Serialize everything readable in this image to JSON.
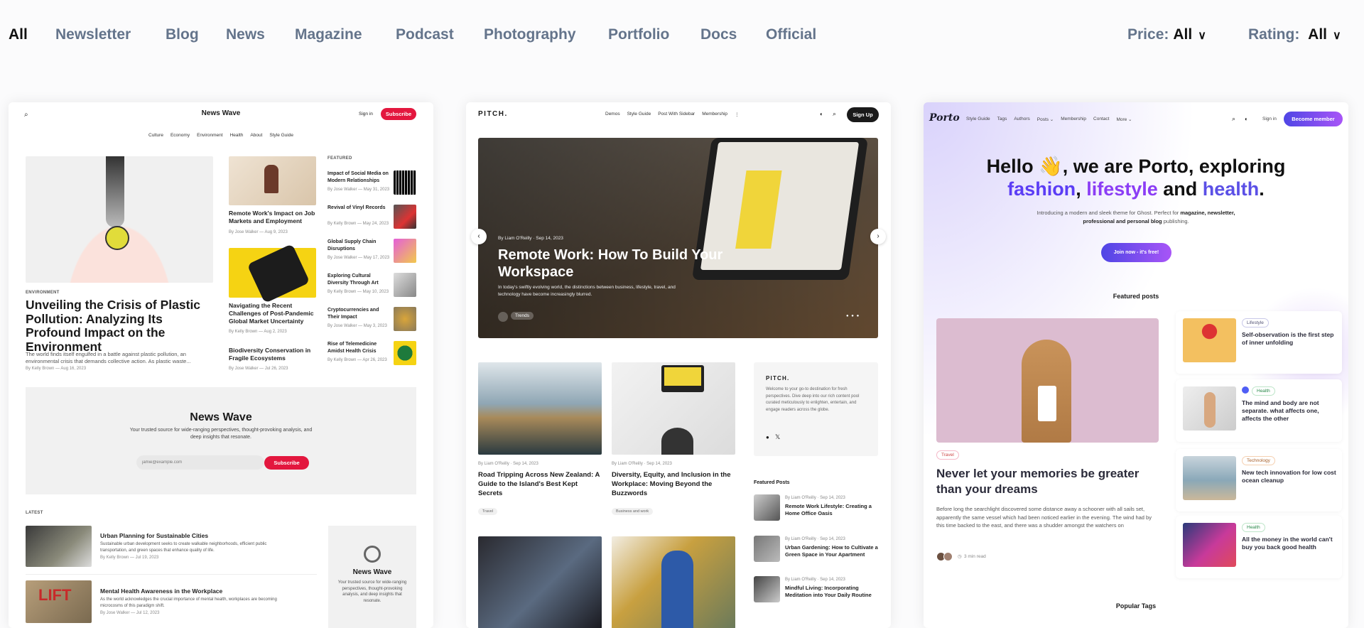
{
  "filters": {
    "categories": [
      "All",
      "Newsletter",
      "Blog",
      "News",
      "Magazine",
      "Podcast",
      "Photography",
      "Portfolio",
      "Docs",
      "Official"
    ],
    "active": "All",
    "price": {
      "label": "Price:",
      "value": "All"
    },
    "rating": {
      "label": "Rating: ",
      "value": "All"
    }
  },
  "newswave": {
    "title": "News Wave",
    "sign_in": "Sign in",
    "subscribe": "Subscribe",
    "nav": [
      "Culture",
      "Economy",
      "Environment",
      "Health",
      "About",
      "Style Guide"
    ],
    "hero": {
      "category": "ENVIRONMENT",
      "title": "Unveiling the Crisis of Plastic Pollution: Analyzing Its Profound Impact on the Environment",
      "excerpt": "The world finds itself engulfed in a battle against plastic pollution, an environmental crisis that demands collective action. As plastic waste...",
      "meta": "By Kelly Brown — Aug 16, 2023"
    },
    "middle": [
      {
        "title": "Remote Work's Impact on Job Markets and Employment",
        "meta": "By Jose Walker — Aug 9, 2023"
      },
      {
        "title": "Navigating the Recent Challenges of Post-Pandemic Global Market Uncertainty",
        "meta": "By Kelly Brown — Aug 2, 2023"
      },
      {
        "title": "Biodiversity Conservation in Fragile Ecosystems",
        "meta": "By Jose Walker — Jul 26, 2023"
      }
    ],
    "featured_label": "FEATURED",
    "featured": [
      {
        "title": "Impact of Social Media on Modern Relationships",
        "meta": "By Jose Walker — May 31, 2023"
      },
      {
        "title": "Revival of Vinyl Records",
        "meta": "By Kelly Brown — May 24, 2023"
      },
      {
        "title": "Global Supply Chain Disruptions",
        "meta": "By Jose Walker — May 17, 2023"
      },
      {
        "title": "Exploring Cultural Diversity Through Art",
        "meta": "By Kelly Brown — May 10, 2023"
      },
      {
        "title": "Cryptocurrencies and Their Impact",
        "meta": "By Jose Walker — May 3, 2023"
      },
      {
        "title": "Rise of Telemedicine Amidst Health Crisis",
        "meta": "By Kelly Brown — Apr 26, 2023"
      }
    ],
    "newsletter": {
      "title": "News Wave",
      "description": "Your trusted source for wide-ranging perspectives, thought-provoking analysis, and deep insights that resonate.",
      "placeholder": "jamie@example.com",
      "button": "Subscribe"
    },
    "latest_label": "LATEST",
    "latest": [
      {
        "title": "Urban Planning for Sustainable Cities",
        "excerpt": "Sustainable urban development seeks to create walkable neighborhoods, efficient public transportation, and green spaces that enhance quality of life.",
        "meta": "By Kelly Brown — Jul 19, 2023"
      },
      {
        "title": "Mental Health Awareness in the Workplace",
        "excerpt": "As the world acknowledges the crucial importance of mental health, workplaces are becoming microcosms of this paradigm shift.",
        "meta": "By Jose Walker — Jul 12, 2023"
      }
    ],
    "sidebar": {
      "title": "News Wave",
      "description": "Your trusted source for wide-ranging perspectives, thought-provoking analysis, and deep insights that resonate."
    },
    "accent": "#e3173e"
  },
  "pitch": {
    "logo": "PITCH.",
    "nav": [
      "Demos",
      "Style Guide",
      "Post With Sidebar",
      "Membership"
    ],
    "sign_up": "Sign Up",
    "hero": {
      "meta": "By Liam O'Reilly · Sep 14, 2023",
      "title": "Remote Work: How To Build Your Workspace",
      "excerpt": "In today's swiftly evolving world, the distinctions between business, lifestyle, travel, and technology have become increasingly blurred.",
      "tag": "Trends"
    },
    "posts": [
      {
        "meta": "By Liam O'Reilly · Sep 14, 2023",
        "title": "Road Tripping Across New Zealand: A Guide to the Island's Best Kept Secrets",
        "tag": "Travel"
      },
      {
        "meta": "By Liam O'Reilly · Sep 14, 2023",
        "title": "Diversity, Equity, and Inclusion in the Workplace: Moving Beyond the Buzzwords",
        "tag": "Business and work"
      }
    ],
    "about": {
      "logo": "PITCH.",
      "description": "Welcome to your go-to destination for fresh perspectives. Dive deep into our rich content pool curated meticulously to enlighten, entertain, and engage readers across the globe."
    },
    "featured_label": "Featured Posts",
    "featured": [
      {
        "meta": "By Liam O'Reilly · Sep 14, 2023",
        "title": "Remote Work Lifestyle: Creating a Home Office Oasis"
      },
      {
        "meta": "By Liam O'Reilly · Sep 14, 2023",
        "title": "Urban Gardening: How to Cultivate a Green Space in Your Apartment"
      },
      {
        "meta": "By Liam O'Reilly · Sep 14, 2023",
        "title": "Mindful Living: Incorporating Meditation into Your Daily Routine"
      }
    ]
  },
  "porto": {
    "logo": "Porto",
    "nav": [
      "Style Guide",
      "Tags",
      "Authors",
      "Posts ⌄",
      "Membership",
      "Contact",
      "More ⌄"
    ],
    "sign_in": "Sign in",
    "cta": "Become member",
    "hero": {
      "line1_a": "Hello ",
      "emoji": "👋",
      "line1_b": ", we are Porto, exploring",
      "w1": "fashion",
      "w2": "lifestyle",
      "and": " and ",
      "w3": "health",
      "subtitle_a": "Introducing a modern and sleek theme for Ghost. Perfect for ",
      "subtitle_b": "magazine, newsletter, professional and personal blog",
      "subtitle_c": " publishing.",
      "button": "Join now - it's free!"
    },
    "featured_label": "Featured posts",
    "main_post": {
      "tag": "Travel",
      "title": "Never let your memories be greater than your dreams",
      "excerpt": "Before long the searchlight discovered some distance away a schooner with all sails set, apparently the same vessel which had been noticed earlier in the evening. The wind had by this time backed to the east, and there was a shudder amongst the watchers on",
      "read_time": "3 min read"
    },
    "side_posts": [
      {
        "tag": "Lifestyle",
        "title": "Self-observation is the first step of inner unfolding"
      },
      {
        "tag": "Health",
        "title": "The mind and body are not separate. what affects one, affects the other"
      },
      {
        "tag": "Technology",
        "title": "New tech innovation for low cost ocean cleanup"
      },
      {
        "tag": "Health",
        "title": "All the money in the world can't buy you back good health"
      }
    ],
    "popular_tags": "Popular Tags",
    "accent": "#5b3df5"
  }
}
